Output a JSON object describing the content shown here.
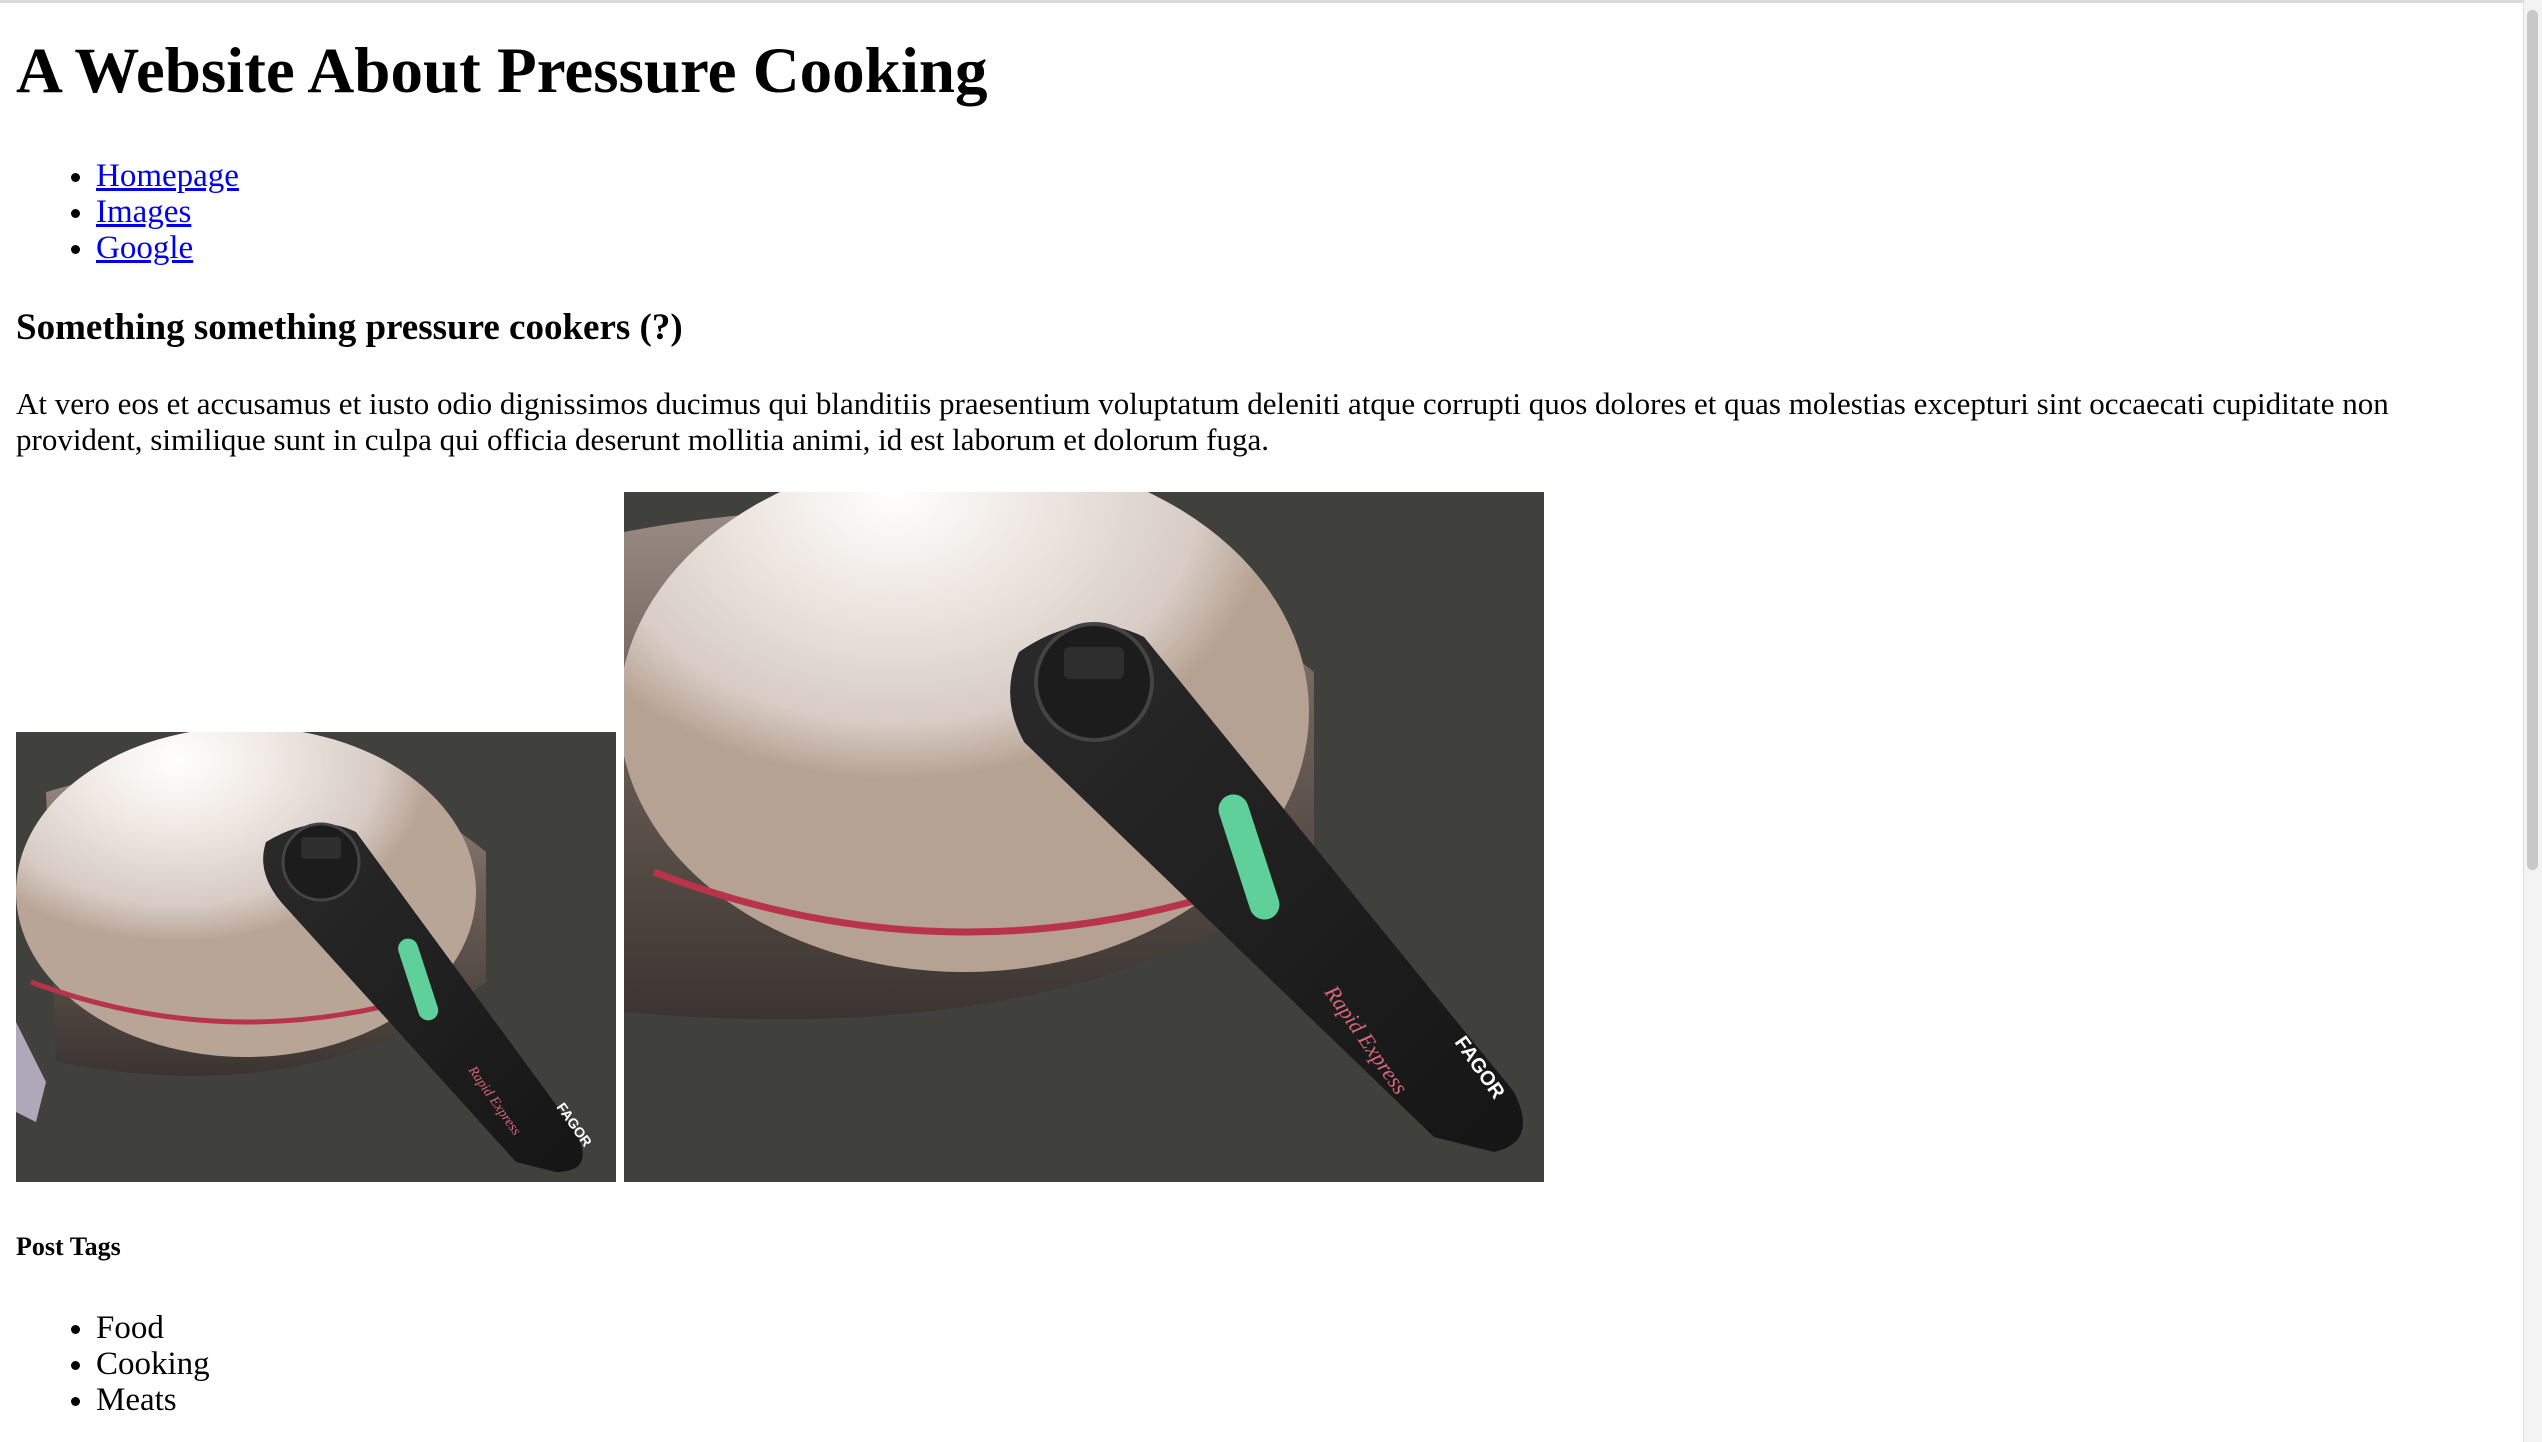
{
  "page": {
    "title": "A Website About Pressure Cooking"
  },
  "nav": {
    "items": [
      "Homepage",
      "Images",
      "Google"
    ]
  },
  "article": {
    "heading": "Something something pressure cookers (?)",
    "paragraph": "At vero eos et accusamus et iusto odio dignissimos ducimus qui blanditiis praesentium voluptatum deleniti atque corrupti quos dolores et quas molestias excepturi sint occaecati cupiditate non provident, similique sunt in culpa qui officia deserunt mollitia animi, id est laborum et dolorum fuga."
  },
  "gallery": {
    "photo_brand": "FAGOR",
    "photo_script": "Rapid Express"
  },
  "tags": {
    "heading": "Post Tags",
    "items": [
      "Food",
      "Cooking",
      "Meats"
    ]
  },
  "colors": {
    "link": "#0000ee",
    "text": "#000000",
    "background": "#ffffff"
  }
}
